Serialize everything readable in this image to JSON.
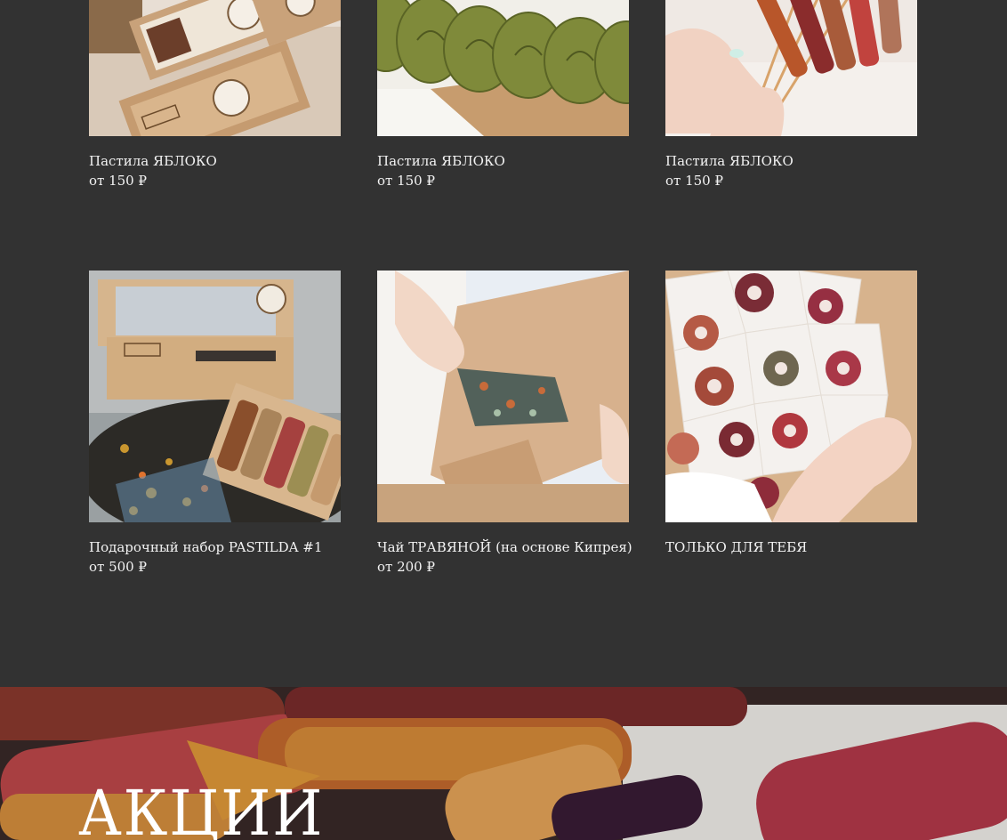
{
  "products": [
    {
      "name": "Пастила ЯБЛОКО",
      "price": "от 150 ₽",
      "image": "kraft gift boxes"
    },
    {
      "name": "Пастила ЯБЛОКО",
      "price": "от 150 ₽",
      "image": "green fruit leather rolls"
    },
    {
      "name": "Пастила ЯБЛОКО",
      "price": "от 150 ₽",
      "image": "fruit leather on sticks"
    },
    {
      "name": "Подарочный набор PASTILDA #1",
      "price": "от 500 ₽",
      "image": "gift set with tea and pastila"
    },
    {
      "name": "Чай ТРАВЯНОЙ (на основе Кипрея)",
      "price": "от 200 ₽",
      "image": "herbal tea kraft bag"
    },
    {
      "name": "ТОЛЬКО ДЛЯ ТЕБЯ",
      "price": "",
      "image": "pastila bouquet"
    }
  ],
  "promo": {
    "title": "АКЦИИ"
  },
  "colors": {
    "background": "#323232",
    "text": "#f2f2f2"
  }
}
